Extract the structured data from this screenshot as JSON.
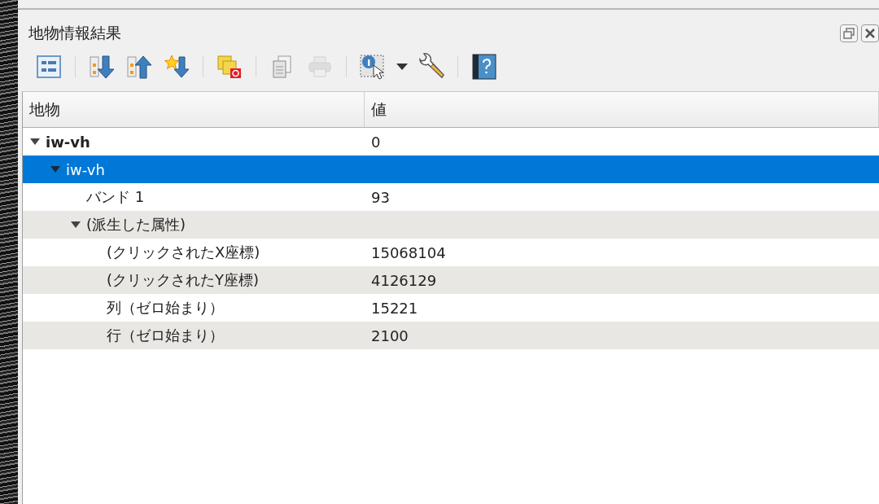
{
  "panel": {
    "title": "地物情報結果"
  },
  "toolbar": [
    {
      "disabled": false
    },
    {
      "disabled": false
    },
    {
      "disabled": false
    },
    {
      "disabled": false
    },
    {
      "disabled": false
    },
    {
      "disabled": false
    },
    {
      "disabled": true
    },
    {
      "disabled": false
    },
    {
      "disabled": false
    },
    {
      "disabled": false
    }
  ],
  "tree": {
    "columns": [
      "地物",
      "値"
    ],
    "rows": [
      {
        "label": "iw-vh",
        "value": "0",
        "bold": true,
        "expanded": true,
        "selected": false,
        "children": [
          {
            "label": "iw-vh",
            "expanded": true,
            "selected": true,
            "children": [
              {
                "label": "バンド 1",
                "value": "93",
                "selected": false
              },
              {
                "label": "(派生した属性)",
                "expanded": true,
                "selected": false,
                "children": [
                  {
                    "label": "(クリックされたX座標)",
                    "value": "15068104",
                    "selected": false
                  },
                  {
                    "label": "(クリックされたY座標)",
                    "value": "4126129",
                    "selected": false
                  },
                  {
                    "label": "列（ゼロ始まり）",
                    "value": "15221",
                    "selected": false
                  },
                  {
                    "label": "行（ゼロ始まり）",
                    "value": "2100",
                    "selected": false
                  }
                ]
              }
            ]
          }
        ]
      }
    ]
  }
}
